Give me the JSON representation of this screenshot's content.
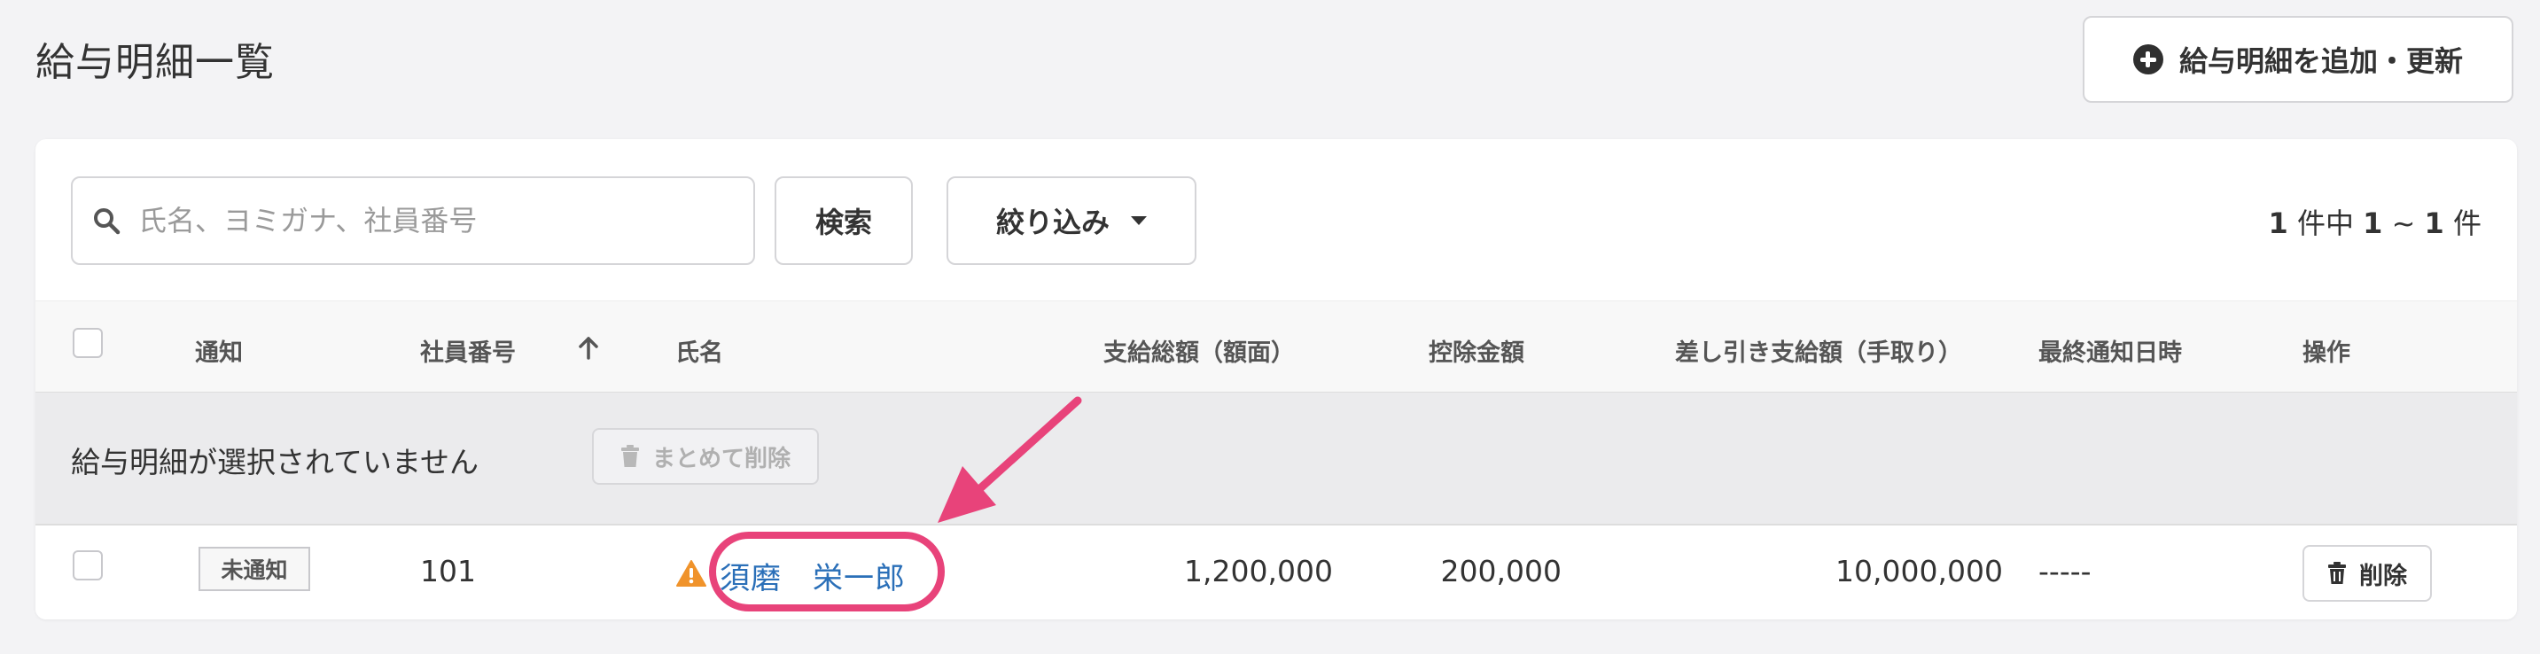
{
  "page": {
    "title": "給与明細一覧",
    "add_button_label": "給与明細を追加・更新"
  },
  "toolbar": {
    "search_placeholder": "氏名、ヨミガナ、社員番号",
    "search_value": "",
    "search_button_label": "検索",
    "filter_button_label": "絞り込み",
    "count_total": "1",
    "count_sep1": " 件中 ",
    "count_from": "1",
    "count_tilde": " ~ ",
    "count_to": "1",
    "count_suffix": " 件"
  },
  "table": {
    "headers": {
      "notice": "通知",
      "employee_no": "社員番号",
      "name": "氏名",
      "gross": "支給総額（額面）",
      "deduction": "控除金額",
      "net": "差し引き支給額（手取り）",
      "last_notified": "最終通知日時",
      "actions": "操作"
    },
    "sort_icon": "arrow-up-icon",
    "bulk": {
      "message": "給与明細が選択されていません",
      "delete_label": "まとめて削除"
    },
    "rows": [
      {
        "status": "未通知",
        "employee_no": "101",
        "name": "須磨　栄一郎",
        "warning_icon": "warning-icon",
        "gross": "1,200,000",
        "deduction": "200,000",
        "net": "10,000,000",
        "last_notified": "-----",
        "delete_label": "削除"
      }
    ]
  },
  "colors": {
    "background": "#f3f3f5",
    "link": "#2a6fb8",
    "highlight": "#e8437a",
    "warning": "#f0932b"
  }
}
